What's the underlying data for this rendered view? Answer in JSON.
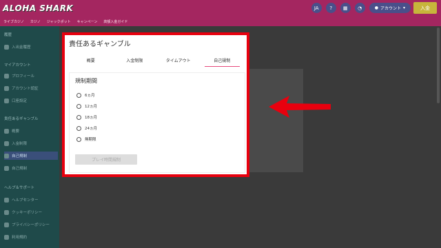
{
  "header": {
    "logo_text": "ALOHA SHARK",
    "icons": [
      "language-icon",
      "help-icon",
      "calendar-icon",
      "bell-icon"
    ],
    "language_label": "JA",
    "account_label": "アカウント",
    "deposit_label": "入金"
  },
  "nav": {
    "items": [
      "ライブカジノ",
      "カジノ",
      "ジャックポット",
      "キャンペーン",
      "高額入金ガイド"
    ]
  },
  "sidebar": {
    "sections": [
      {
        "heading": "履歴",
        "items": [
          "入出金履歴"
        ]
      },
      {
        "heading": "マイアカウント",
        "items": [
          "プロフィール",
          "アカウント認証",
          "口座設定"
        ]
      },
      {
        "heading": "責任あるギャンブル",
        "items": [
          "概要",
          "入金制限",
          "自己規制",
          "自己規制"
        ]
      },
      {
        "heading": "ヘルプ＆サポート",
        "items": [
          "ヘルプセンター",
          "クッキーポリシー",
          "プライバシーポリシー",
          "利用規約"
        ]
      }
    ],
    "active_item": "自己規制"
  },
  "modal": {
    "title": "責任あるギャンブル",
    "tabs": [
      "概要",
      "入金制限",
      "タイムアウト",
      "自己規制"
    ],
    "active_tab": "自己規制",
    "section_title": "規制期間",
    "options": [
      "6ヵ月",
      "12ヵ月",
      "18ヵ月",
      "24ヵ月",
      "無期限"
    ],
    "submit_label": "プレイ時間規制"
  },
  "colors": {
    "header_bg": "#a42660",
    "highlight_border": "#e8000e",
    "active_tab_underline": "#e74a7c",
    "deposit_button": "#c7b53b"
  }
}
